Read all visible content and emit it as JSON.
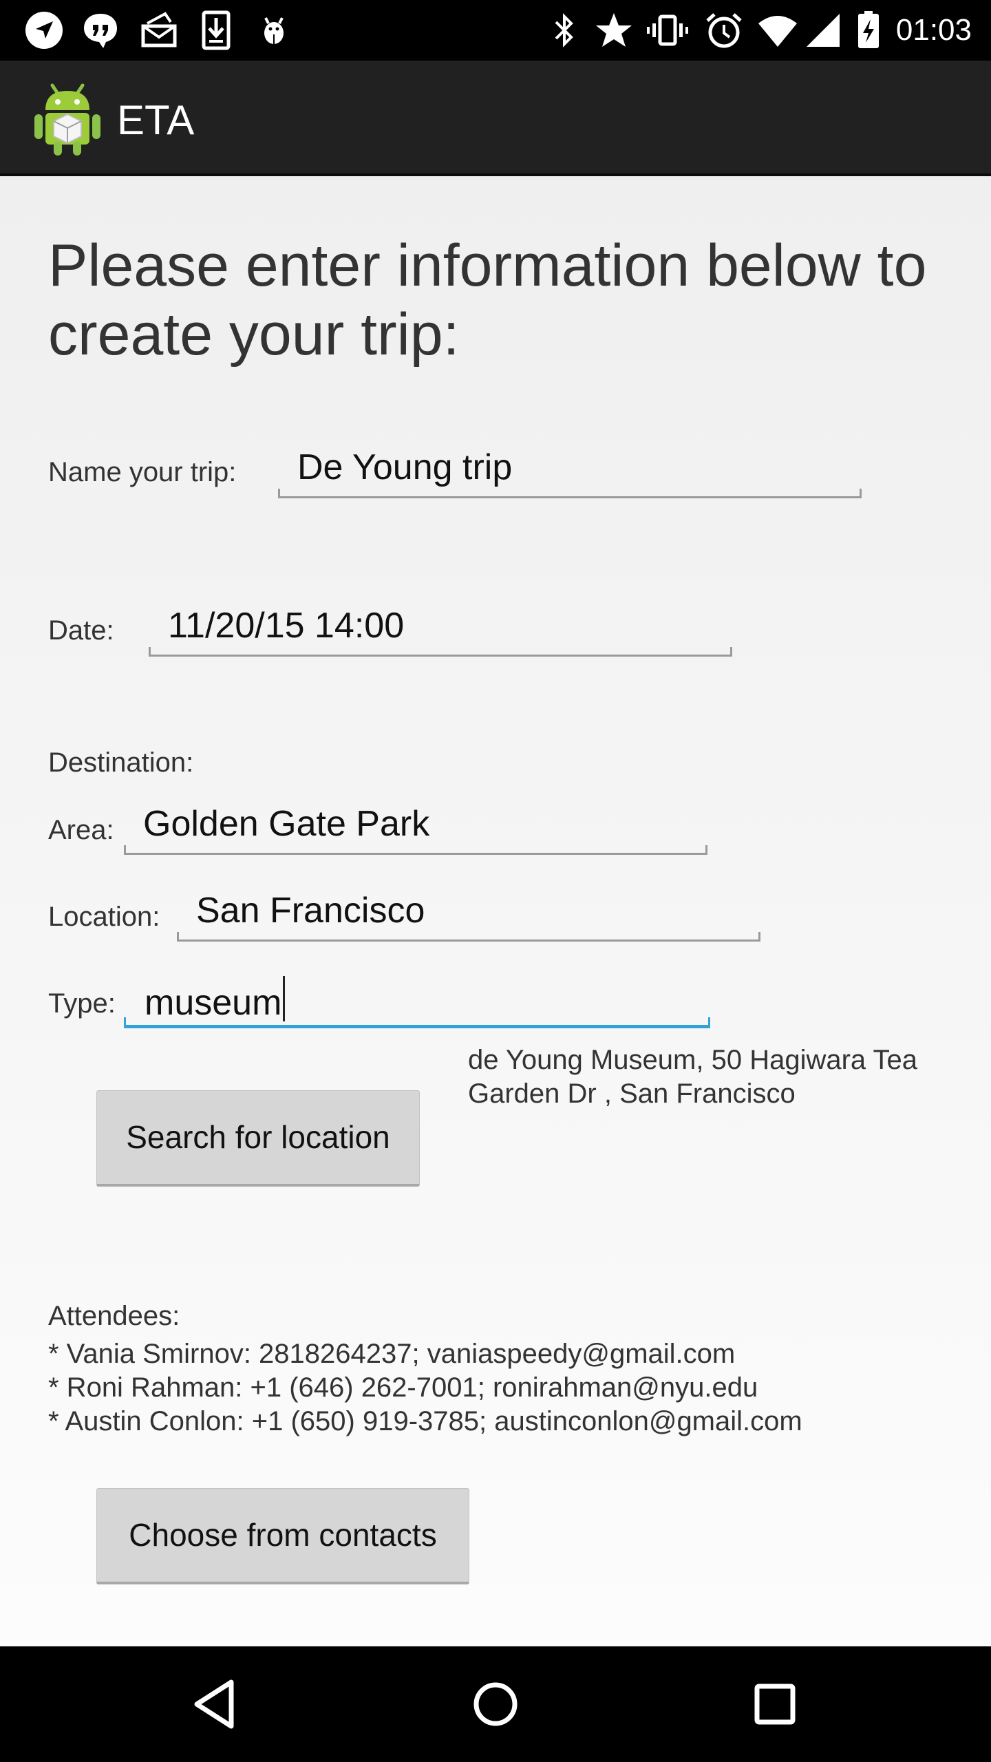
{
  "status_bar": {
    "time": "01:03",
    "left_icons": [
      "navigation-icon",
      "quote-icon",
      "mail-icon",
      "download-icon",
      "android-debug-icon"
    ],
    "right_icons": [
      "bluetooth-icon",
      "star-icon",
      "vibrate-icon",
      "alarm-icon",
      "wifi-icon",
      "signal-icon",
      "battery-charging-icon"
    ]
  },
  "app_bar": {
    "title": "ETA",
    "logo_icon": "android-app-icon"
  },
  "form": {
    "headline": "Please enter information below to create your trip:",
    "trip_name": {
      "label": "Name your trip:",
      "value": "De Young trip"
    },
    "date": {
      "label": "Date:",
      "value": "11/20/15 14:00"
    },
    "destination_label": "Destination:",
    "area": {
      "label": "Area:",
      "value": "Golden Gate Park"
    },
    "location": {
      "label": "Location:",
      "value": "San Francisco"
    },
    "type": {
      "label": "Type:",
      "value": "museum"
    },
    "search_result": "de Young Museum, 50 Hagiwara Tea Garden Dr , San Francisco",
    "search_button": "Search for location"
  },
  "attendees": {
    "label": "Attendees:",
    "items": [
      "* Vania Smirnov: 2818264237; vaniaspeedy@gmail.com",
      "* Roni Rahman: +1 (646) 262-7001; ronirahman@nyu.edu",
      "* Austin Conlon: +1 (650) 919-3785; austinconlon@gmail.com"
    ],
    "choose_button": "Choose from contacts"
  },
  "colors": {
    "status_bar": "#000000",
    "app_bar": "#212121",
    "focus_underline": "#33a3d6",
    "button": "#d6d6d6"
  }
}
